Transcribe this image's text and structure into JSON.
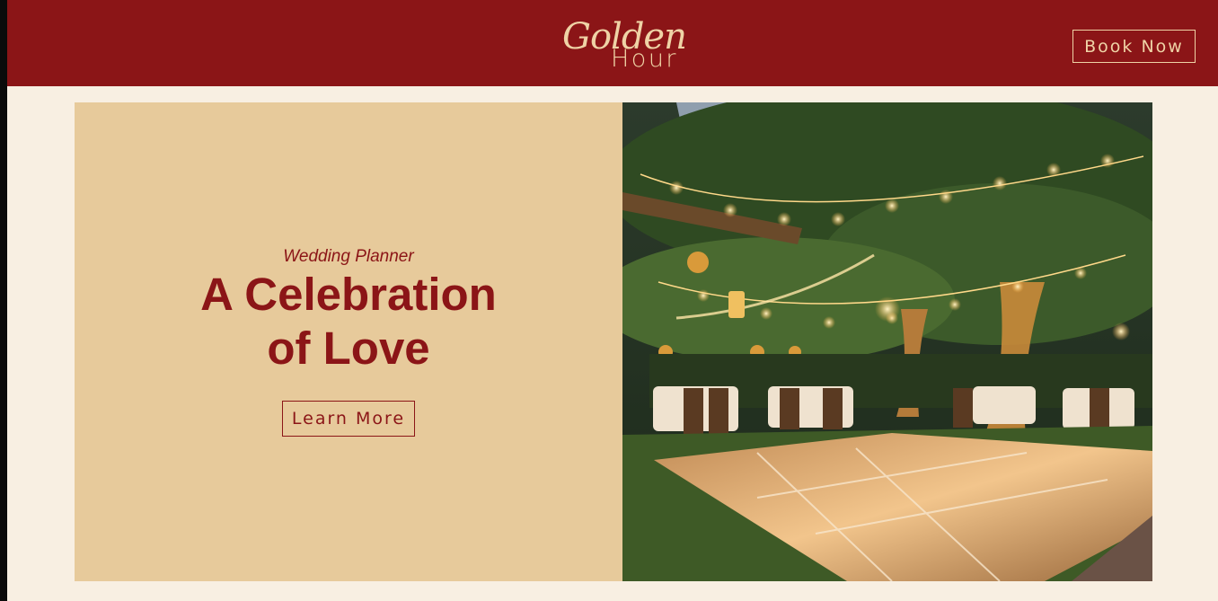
{
  "brand": {
    "logo_script": "Golden",
    "logo_sub": "Hour"
  },
  "header": {
    "book_label": "Book Now"
  },
  "hero": {
    "kicker": "Wedding Planner",
    "headline_line1": "A Celebration",
    "headline_line2": "of Love",
    "cta_label": "Learn More"
  },
  "colors": {
    "brand_red": "#8b1517",
    "gold": "#efd3a6",
    "tan_panel": "#e7ca9b",
    "page_bg": "#f8efe2"
  }
}
